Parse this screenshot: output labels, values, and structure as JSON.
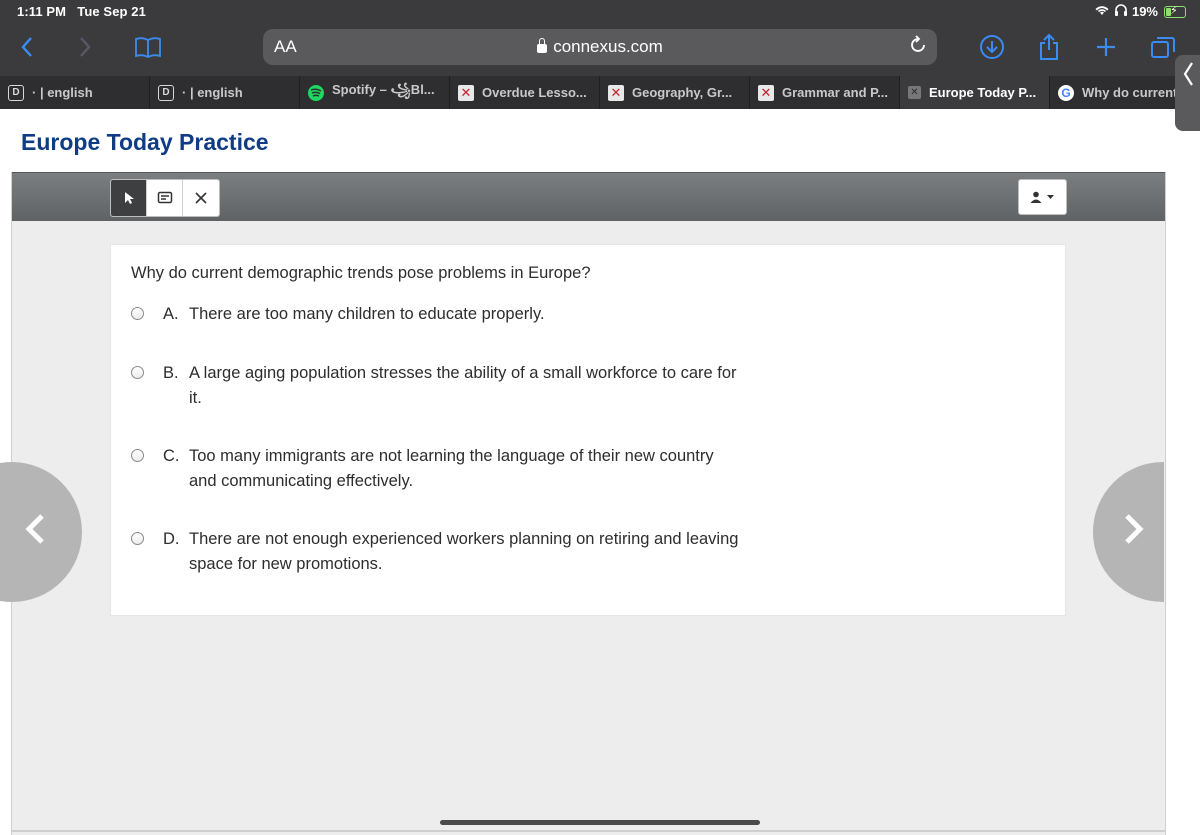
{
  "status_bar": {
    "time": "1:11 PM",
    "date": "Tue Sep 21",
    "battery": "19%"
  },
  "browser": {
    "text_size_button": "AA",
    "url": "connexus.com",
    "accent_color": "#3a8cf3",
    "tabs": [
      {
        "favicon": "D",
        "label": "· | english",
        "active": false
      },
      {
        "favicon": "D",
        "label": "· | english",
        "active": false
      },
      {
        "favicon": "spotify-icon",
        "label": "Spotify – ꧁Bl...",
        "active": false
      },
      {
        "favicon": "x-icon",
        "label": "Overdue Lesso...",
        "active": false
      },
      {
        "favicon": "x-icon",
        "label": "Geography, Gr...",
        "active": false
      },
      {
        "favicon": "x-icon",
        "label": "Grammar and P...",
        "active": false
      },
      {
        "favicon": "close-icon",
        "label": "Europe Today P...",
        "active": true
      },
      {
        "favicon": "G",
        "label": "Why do current",
        "active": false
      }
    ]
  },
  "page": {
    "title": "Europe Today Practice",
    "title_color": "#0f3c84"
  },
  "toolbar": {
    "tools": [
      "pointer-icon",
      "note-icon",
      "eliminate-icon"
    ],
    "selected_tool": "pointer-icon",
    "user_menu_icon": "user-icon"
  },
  "question": {
    "prompt": "Why do current demographic trends pose problems in Europe?",
    "choices": [
      {
        "letter": "A.",
        "text": "There are too many children to educate properly."
      },
      {
        "letter": "B.",
        "text": "A large aging population stresses the ability of a small workforce to care for it."
      },
      {
        "letter": "C.",
        "text": "Too many immigrants are not learning the language of their new country and communicating effectively."
      },
      {
        "letter": "D.",
        "text": "There are not enough experienced workers planning on retiring and leaving space for new promotions."
      }
    ]
  },
  "navigation": {
    "previous_icon": "chevron-left-icon",
    "next_icon": "chevron-right-icon"
  }
}
